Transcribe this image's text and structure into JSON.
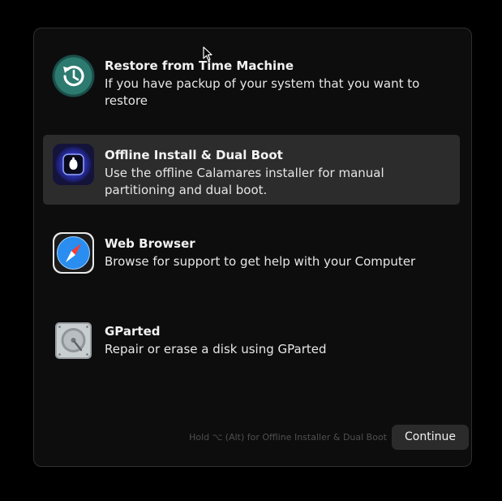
{
  "options": [
    {
      "title": "Restore from Time Machine",
      "description": "If you have packup of your system that you want to restore",
      "icon": "time-machine-icon",
      "selected": false
    },
    {
      "title": "Offline Install & Dual Boot",
      "description": "Use the offline Calamares installer for manual partitioning and dual boot.",
      "icon": "installer-icon",
      "selected": true
    },
    {
      "title": "Web Browser",
      "description": "Browse for support to get help with your Computer",
      "icon": "safari-compass-icon",
      "selected": false
    },
    {
      "title": "GParted",
      "description": "Repair or erase a disk using GParted",
      "icon": "hard-disk-icon",
      "selected": false
    }
  ],
  "footer": {
    "hint": "Hold ⌥ (Alt) for Offline Installer & Dual Boot",
    "continue_label": "Continue"
  },
  "colors": {
    "window_bg": "#0d0d0d",
    "selected_bg": "#2c2c2c",
    "time_machine_green": "#2d7a70",
    "safari_blue": "#2a8df0"
  }
}
